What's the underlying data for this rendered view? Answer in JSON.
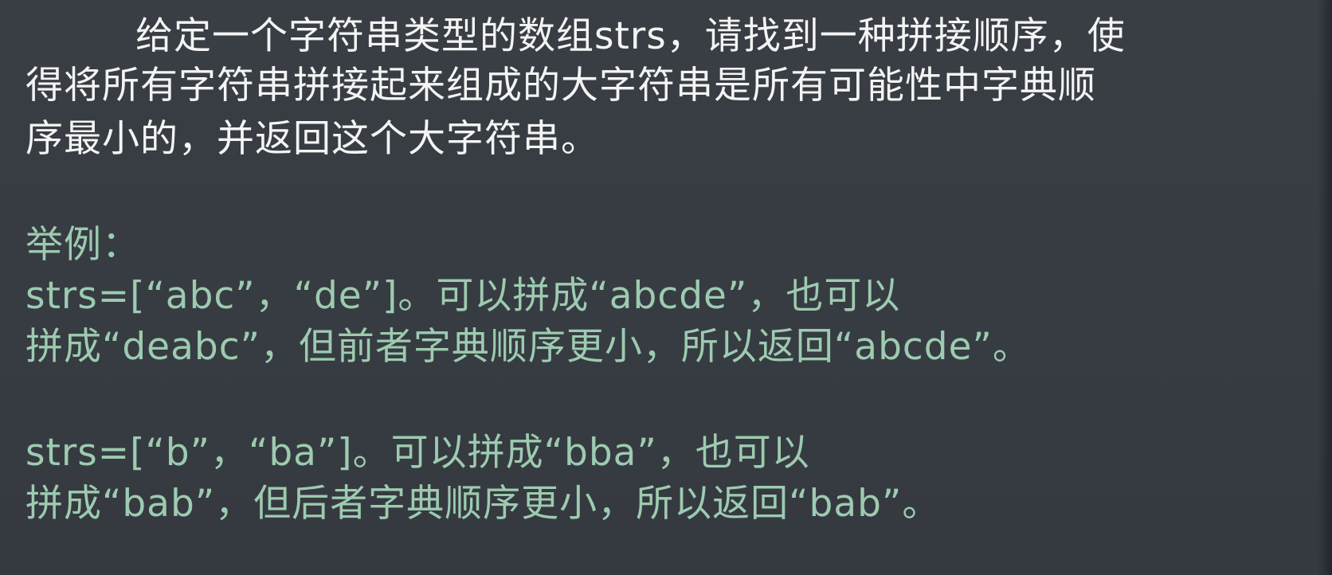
{
  "problem": {
    "line1": "给定一个字符串类型的数组strs，请找到一种拼接顺序，使",
    "line2": "得将所有字符串拼接起来组成的大字符串是所有可能性中字典顺",
    "line3": "序最小的，并返回这个大字符串。"
  },
  "examples": {
    "heading": "举例：",
    "example1": {
      "line1": "strs=[“abc”，“de”]。可以拼成“abcde”，也可以",
      "line2": "拼成“deabc”，但前者字典顺序更小，所以返回“abcde”。"
    },
    "example2": {
      "line1": "strs=[“b”，“ba”]。可以拼成“bba”，也可以",
      "line2": "拼成“bab”，但后者字典顺序更小，所以返回“bab”。"
    }
  }
}
